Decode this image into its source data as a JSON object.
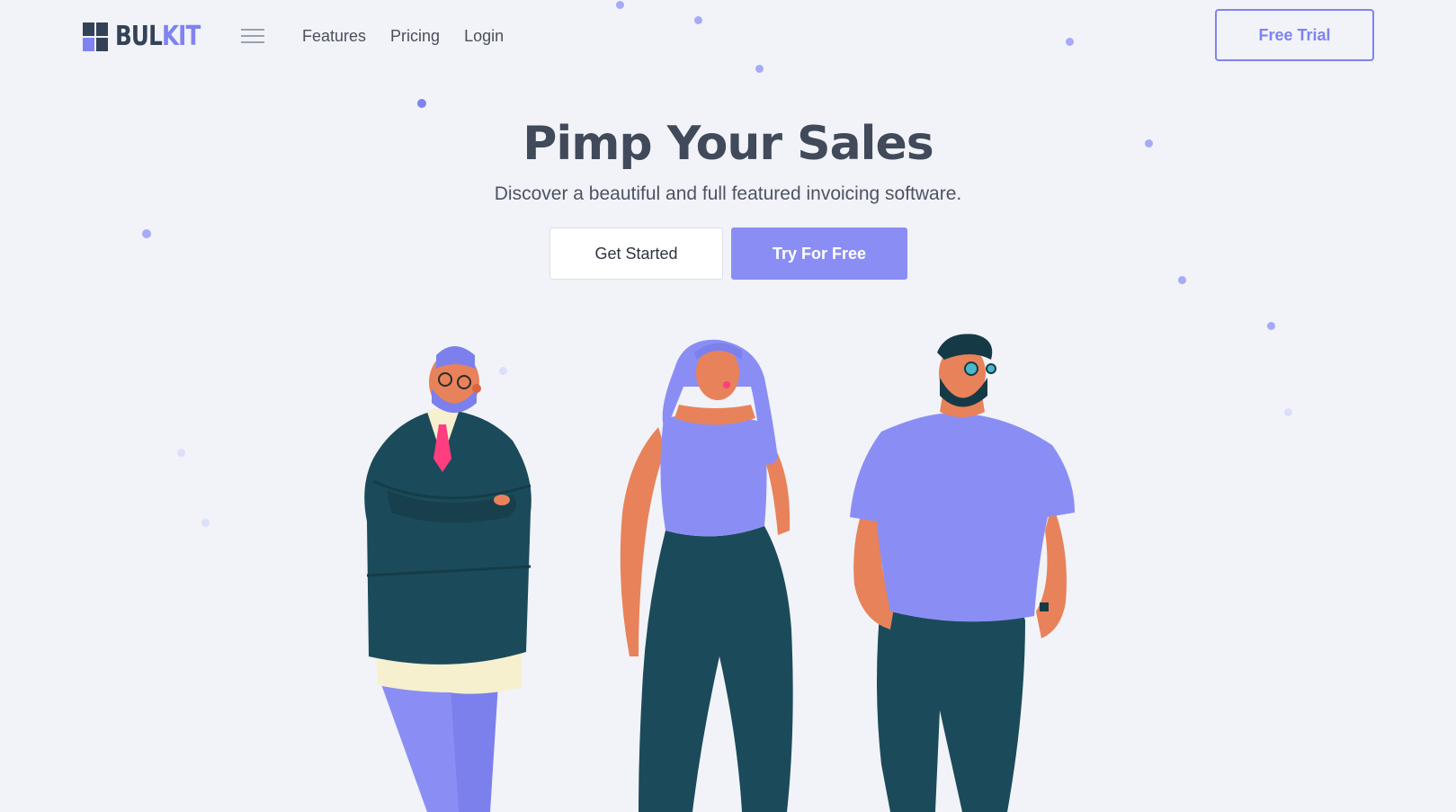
{
  "brand": {
    "name_part1": "BUL",
    "name_part2": "KIT",
    "primary_color": "#7f83f0",
    "dark_color": "#344258"
  },
  "nav": {
    "menu_icon": "hamburger-icon",
    "links": [
      "Features",
      "Pricing",
      "Login"
    ],
    "cta_label": "Free Trial"
  },
  "hero": {
    "title": "Pimp Your Sales",
    "subtitle": "Discover a beautiful and full featured invoicing software.",
    "primary_button": "Try For Free",
    "secondary_button": "Get Started"
  },
  "illustration": {
    "description_icon": "three-people-illustration",
    "colors": {
      "teal": "#1b4b5a",
      "purple": "#8a8ef4",
      "skin": "#e8825a",
      "pink_tie": "#ff3d7f",
      "cream": "#f6f0cf"
    }
  }
}
